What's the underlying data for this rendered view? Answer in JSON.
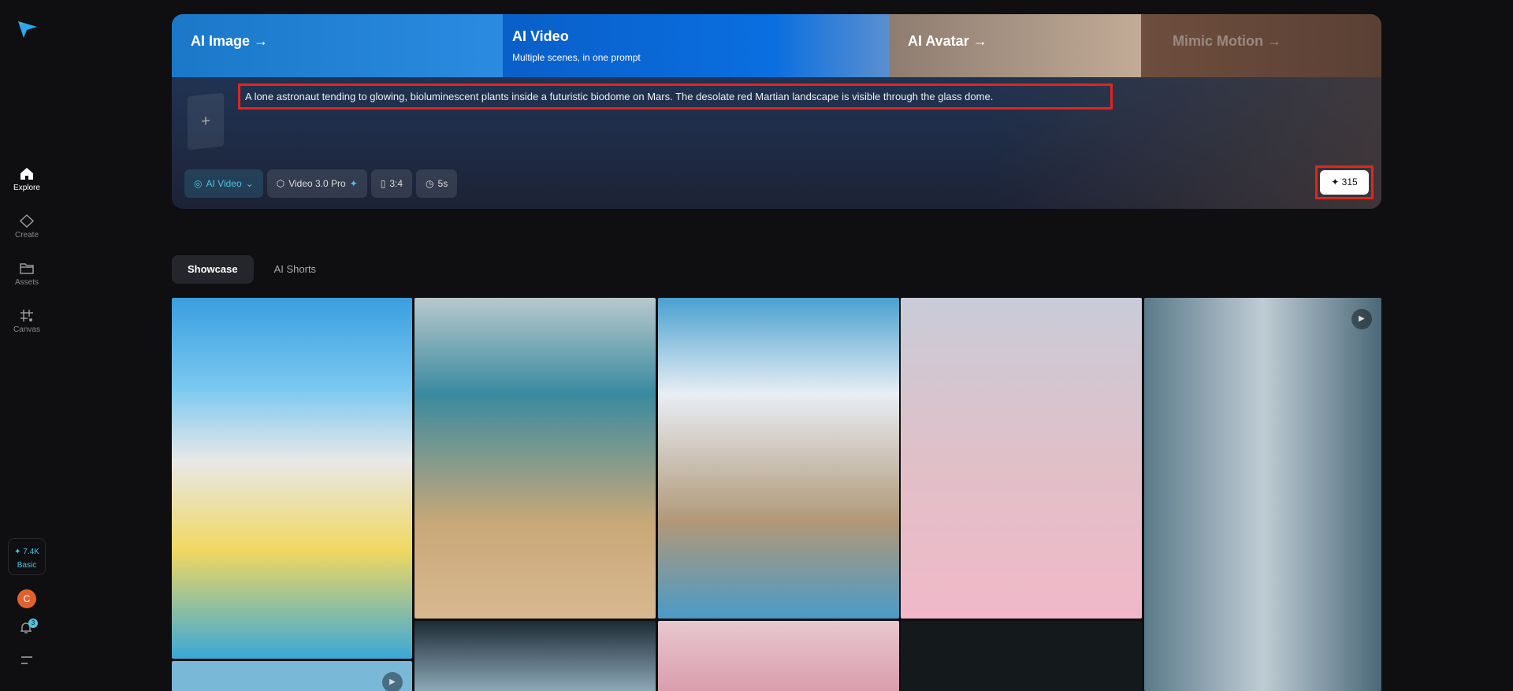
{
  "sidebar": {
    "items": [
      {
        "label": "Explore"
      },
      {
        "label": "Create"
      },
      {
        "label": "Assets"
      },
      {
        "label": "Canvas"
      }
    ],
    "credits": "✦ 7.4K",
    "plan": "Basic",
    "avatar_initial": "C",
    "notifications": "3"
  },
  "banner": {
    "tabs": [
      {
        "label": "AI Image →"
      },
      {
        "label": "AI Video",
        "subtitle": "Multiple scenes, in one prompt"
      },
      {
        "label": "AI Avatar →"
      },
      {
        "label": "Mimic Motion →"
      }
    ]
  },
  "prompt": {
    "text": "A lone astronaut tending to glowing, bioluminescent plants inside a futuristic biodome on Mars. The desolate red Martian landscape is visible through the glass dome.",
    "upload": "+"
  },
  "options": {
    "mode": "AI Video",
    "model": "Video 3.0 Pro",
    "ratio": "3:4",
    "duration": "5s"
  },
  "generate": {
    "label": "✦ 315"
  },
  "tabs": [
    {
      "label": "Showcase"
    },
    {
      "label": "AI Shorts"
    }
  ],
  "accent": "#4ec3e0"
}
